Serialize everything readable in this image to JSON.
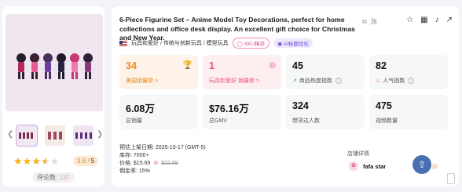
{
  "product": {
    "title": "6-Piece Figurine Set – Anime Model Toy Decorations, perfect for home collections and office desk display. An excellent gift choice for Christmas and New Year.",
    "category_path": "玩具和爱好 / 传统与创新玩具 / 模型玩具",
    "tag_sku": "SKU稀存",
    "tag_ai": "AI标题优化",
    "rating_value": "3.6",
    "rating_max": "5",
    "rating_stars": 3.6,
    "review_label": "评论数:",
    "review_count": "137"
  },
  "stats_row1": [
    {
      "value": "34",
      "label": "美国销量榜 >",
      "tone": "warm",
      "icon": "trophy-icon"
    },
    {
      "value": "1",
      "label": "玩具和爱好 销量榜 >",
      "tone": "pink",
      "icon": "target-icon"
    },
    {
      "value": "45",
      "label": "商品热度指数",
      "tone": "plain",
      "icon": "trend-icon"
    },
    {
      "value": "82",
      "label": "人气指数",
      "tone": "plain",
      "icon": "flame-icon"
    }
  ],
  "stats_row2": [
    {
      "value": "6.08万",
      "label": "总销量"
    },
    {
      "value": "$76.16万",
      "label": "总GMV"
    },
    {
      "value": "324",
      "label": "带货达人数"
    },
    {
      "value": "475",
      "label": "视频数量"
    }
  ],
  "details": {
    "launch_label": "预估上架日期:",
    "launch_value": "2025-10-17 (GMT-5)",
    "stock_label": "库存:",
    "stock_value": "7000+",
    "price_label": "价格:",
    "price_value": "$15.69",
    "price_original": "$22.99",
    "commission_label": "佣金率:",
    "commission_value": "15%"
  },
  "store": {
    "section_label": "店铺详情",
    "name": "fafa star",
    "badge": "好"
  },
  "colors": {
    "accent_orange": "#e68a1e",
    "accent_pink": "#ec4d86",
    "star": "#f5b21c",
    "fab": "#4a6fb0"
  }
}
